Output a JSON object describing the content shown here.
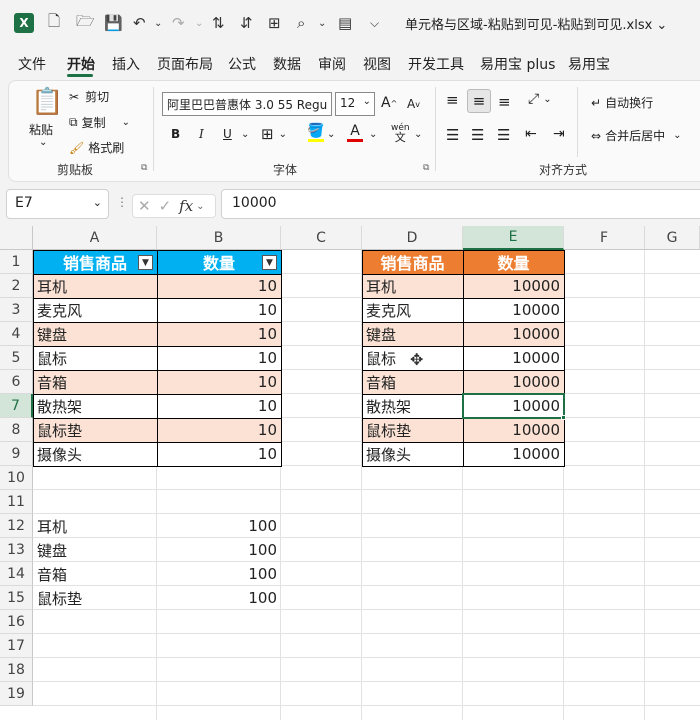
{
  "title": "单元格与区域-粘贴到可见-粘贴到可见.xlsx",
  "menu": [
    "文件",
    "开始",
    "插入",
    "页面布局",
    "公式",
    "数据",
    "审阅",
    "视图",
    "开发工具",
    "易用宝 plus",
    "易用宝"
  ],
  "ribbon": {
    "paste": "粘贴",
    "cut": "剪切",
    "copy": "复制",
    "format_painter": "格式刷",
    "clipboard_group": "剪贴板",
    "font_name": "阿里巴巴普惠体 3.0 55 Regu",
    "font_size": "12",
    "bold": "B",
    "italic": "I",
    "underline": "U",
    "font_color_glyph": "A",
    "grow_font": "A",
    "shrink_font": "A",
    "wen": "wén",
    "wen2": "文",
    "font_group": "字体",
    "wrap_text": "自动换行",
    "merge_center": "合并后居中",
    "align_group": "对齐方式"
  },
  "formula_bar": {
    "name_box": "E7",
    "fx": "fx",
    "value": "10000"
  },
  "columns": [
    "A",
    "B",
    "C",
    "D",
    "E",
    "F",
    "G"
  ],
  "rows": [
    "1",
    "2",
    "3",
    "4",
    "5",
    "6",
    "7",
    "8",
    "9",
    "10",
    "11",
    "12",
    "13",
    "14",
    "15",
    "16",
    "17",
    "18",
    "19"
  ],
  "table1": {
    "headers": [
      "销售商品",
      "数量"
    ],
    "rows": [
      [
        "耳机",
        "10"
      ],
      [
        "麦克风",
        "10"
      ],
      [
        "键盘",
        "10"
      ],
      [
        "鼠标",
        "10"
      ],
      [
        "音箱",
        "10"
      ],
      [
        "散热架",
        "10"
      ],
      [
        "鼠标垫",
        "10"
      ],
      [
        "摄像头",
        "10"
      ]
    ]
  },
  "table2": {
    "headers": [
      "销售商品",
      "数量"
    ],
    "rows": [
      [
        "耳机",
        "10000"
      ],
      [
        "麦克风",
        "10000"
      ],
      [
        "键盘",
        "10000"
      ],
      [
        "鼠标",
        "10000"
      ],
      [
        "音箱",
        "10000"
      ],
      [
        "散热架",
        "10000"
      ],
      [
        "鼠标垫",
        "10000"
      ],
      [
        "摄像头",
        "10000"
      ]
    ]
  },
  "list": [
    [
      "耳机",
      "100"
    ],
    [
      "键盘",
      "100"
    ],
    [
      "音箱",
      "100"
    ],
    [
      "鼠标垫",
      "100"
    ]
  ],
  "colors": {
    "table1_header": "#00b0f0",
    "table2_header": "#ed7d31",
    "band": "#fbe2d5",
    "accent": "#1e7145"
  }
}
